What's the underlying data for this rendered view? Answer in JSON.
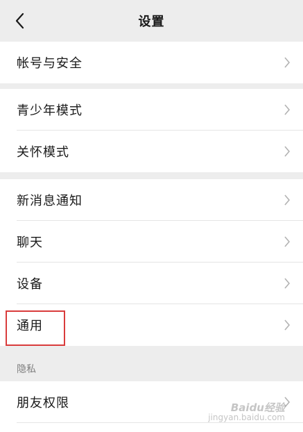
{
  "header": {
    "title": "设置"
  },
  "groups": {
    "account": {
      "items": [
        {
          "label": "帐号与安全"
        }
      ]
    },
    "modes": {
      "items": [
        {
          "label": "青少年模式"
        },
        {
          "label": "关怀模式"
        }
      ]
    },
    "general": {
      "items": [
        {
          "label": "新消息通知"
        },
        {
          "label": "聊天"
        },
        {
          "label": "设备"
        },
        {
          "label": "通用"
        }
      ]
    },
    "privacy": {
      "header": "隐私",
      "items": [
        {
          "label": "朋友权限"
        }
      ]
    }
  },
  "highlight": {
    "target": "通用",
    "color": "#d93b3b"
  },
  "watermark": {
    "logo": "Baidu经验",
    "url": "jingyan.baidu.com"
  },
  "colors": {
    "background": "#ededed",
    "row": "#ffffff",
    "chevron": "#b2b2b2"
  }
}
